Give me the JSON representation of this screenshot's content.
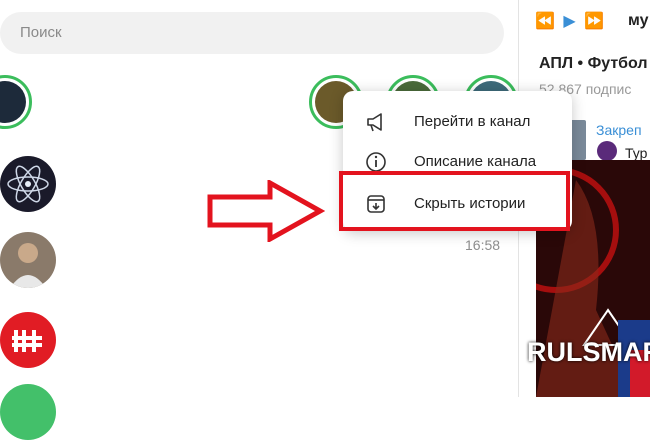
{
  "search": {
    "placeholder": "Поиск"
  },
  "chats": [
    {
      "time": "16:58"
    }
  ],
  "context_menu": {
    "items": [
      {
        "label": "Перейти в канал",
        "icon": "megaphone-icon"
      },
      {
        "label": "Описание канала",
        "icon": "info-icon"
      },
      {
        "label": "Скрыть истории",
        "icon": "archive-icon"
      }
    ]
  },
  "right_panel": {
    "player_title": "му",
    "channel_title": "АПЛ • Футбол",
    "channel_subscribers": "52 867 подпис",
    "pinned_label": "Закреп",
    "pinned_text": "Тур"
  },
  "watermark": "RULSMART",
  "colors": {
    "accent": "#3a8fd6",
    "story_ring": "#3bbd5c",
    "highlight": "#e3131e"
  }
}
